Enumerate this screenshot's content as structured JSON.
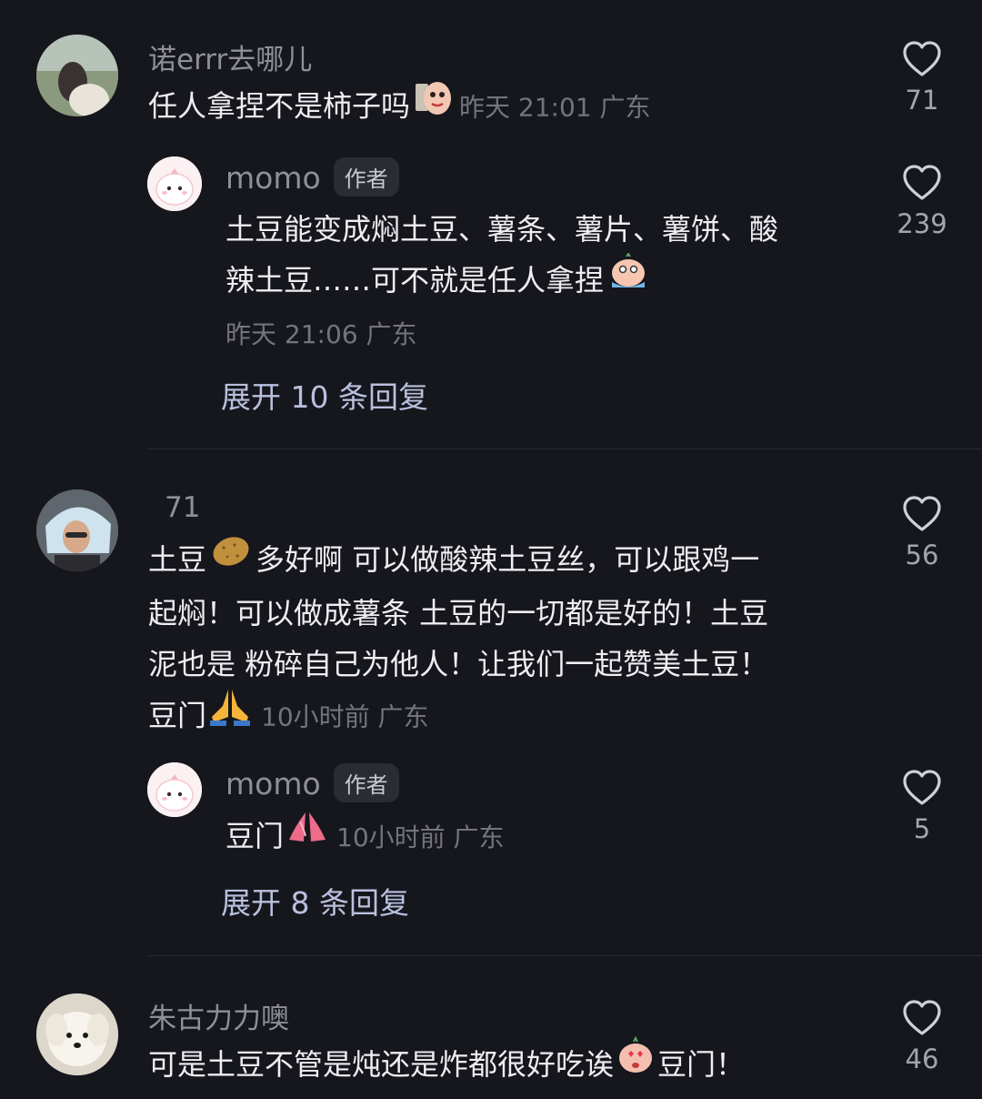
{
  "comments": [
    {
      "username": "诺errr去哪儿",
      "text": "任人拿捏不是柿子吗",
      "time": "昨天 21:01 广东",
      "likes": "71",
      "reply": {
        "username": "momo",
        "badge": "作者",
        "text_line1": "土豆能变成焖土豆、薯条、薯片、薯饼、酸",
        "text_line2": "辣土豆……可不就是任人拿捏",
        "time": "昨天 21:06 广东",
        "likes": "239"
      },
      "expand_label": "展开 10 条回复"
    },
    {
      "username": "71",
      "text_line1_a": "土豆",
      "text_line1_b": "多好啊  可以做酸辣土豆丝，可以跟鸡一",
      "text_line2": "起焖！可以做成薯条  土豆的一切都是好的！土豆",
      "text_line3": "泥也是  粉碎自己为他人！让我们一起赞美土豆！",
      "text_line4": "豆门",
      "time": "10小时前 广东",
      "likes": "56",
      "reply": {
        "username": "momo",
        "badge": "作者",
        "text": "豆门",
        "time": "10小时前 广东",
        "likes": "5"
      },
      "expand_label": "展开 8 条回复"
    },
    {
      "username": "朱古力力噢",
      "text_a": "可是土豆不管是炖还是炸都很好吃诶",
      "text_b": "豆门！",
      "likes": "46"
    }
  ],
  "icons": {
    "like": "heart-outline-icon",
    "emoji_1": "mischievous-potato-emoji",
    "emoji_2": "crying-face-emoji",
    "emoji_3": "potato-emoji",
    "emoji_4": "praying-hands-emoji",
    "emoji_5": "pink-praying-hands-emoji",
    "emoji_6": "heart-eyes-emoji"
  },
  "colors": {
    "background": "#16161d",
    "username": "#8f8f99",
    "text": "#ededf2",
    "meta": "#74747f",
    "expand": "#b9c0dd"
  }
}
